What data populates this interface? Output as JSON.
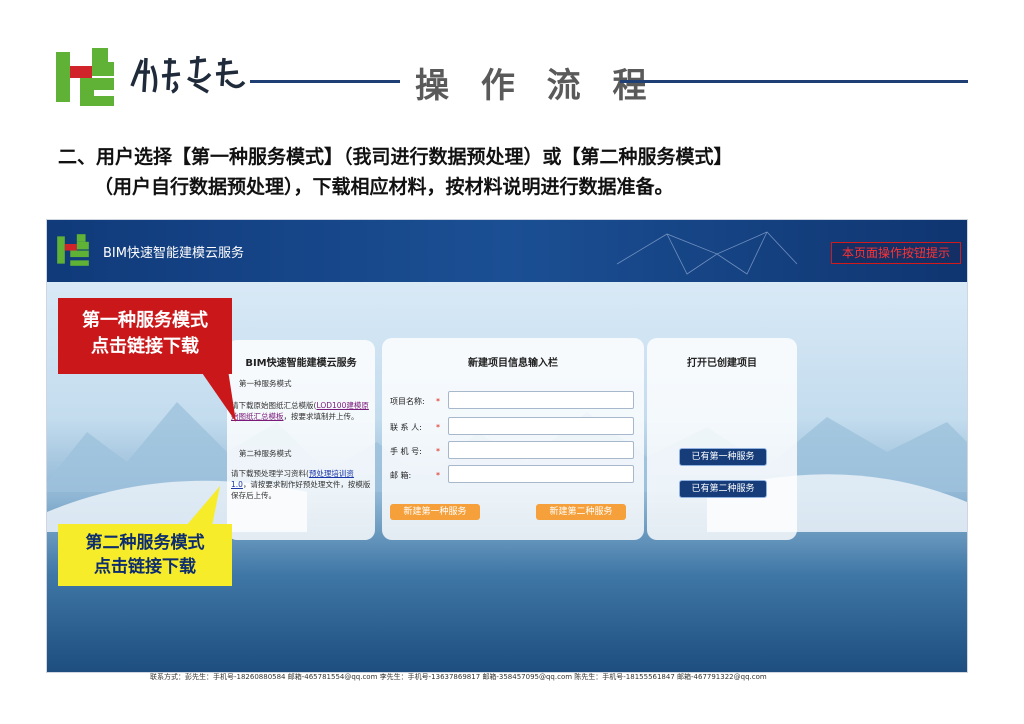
{
  "header": {
    "title": "操 作 流 程"
  },
  "heading": {
    "line1": "二、用户选择【第一种服务模式】（我司进行数据预处理）或【第二种服务模式】",
    "line2": "（用户自行数据预处理），下载相应材料，按材料说明进行数据准备。"
  },
  "app": {
    "brand": "BIM快速智能建模云服务",
    "help_button": "本页面操作按钮提示"
  },
  "panel_modes": {
    "title": "BIM快速智能建模云服务",
    "mode1_label": "第一种服务模式",
    "mode1_text_prefix": "请下载原始图纸汇总模版",
    "mode1_link": "LOD100建模原始图纸汇总模板",
    "mode1_text_suffix": "，按要求填制并上传。",
    "mode2_label": "第二种服务模式",
    "mode2_text_prefix": "请下载预处理学习资料",
    "mode2_link": "预处理培训资1.0",
    "mode2_text_suffix": "，请按要求制作好预处理文件，按模版保存后上传。"
  },
  "panel_new": {
    "title": "新建项目信息输入栏",
    "fields": [
      {
        "label": "项目名称:",
        "value": ""
      },
      {
        "label": "联 系 人:",
        "value": ""
      },
      {
        "label": "手 机 号:",
        "value": ""
      },
      {
        "label": "邮    箱:",
        "value": ""
      }
    ],
    "btn_mode1": "新建第一种服务",
    "btn_mode2": "新建第二种服务"
  },
  "panel_open": {
    "title": "打开已创建项目",
    "btn_mode1": "已有第一种服务",
    "btn_mode2": "已有第二种服务"
  },
  "callouts": {
    "red_line1": "第一种服务模式",
    "red_line2": "点击链接下载",
    "yellow_line1": "第二种服务模式",
    "yellow_line2": "点击链接下载"
  },
  "footer": {
    "contact": "联系方式：彭先生：手机号-18260880584 邮箱-465781554@qq.com  李先生：手机号-13637869817 邮箱-358457095@qq.com  陈先生：手机号-18155561847 邮箱-467791322@qq.com"
  },
  "colors": {
    "accent_navy": "#1f3e73",
    "logo_green": "#5fb236",
    "logo_red": "#d1232a",
    "callout_red": "#c9171a",
    "callout_yellow": "#f7ec2a",
    "btn_orange": "#f5a03a"
  }
}
